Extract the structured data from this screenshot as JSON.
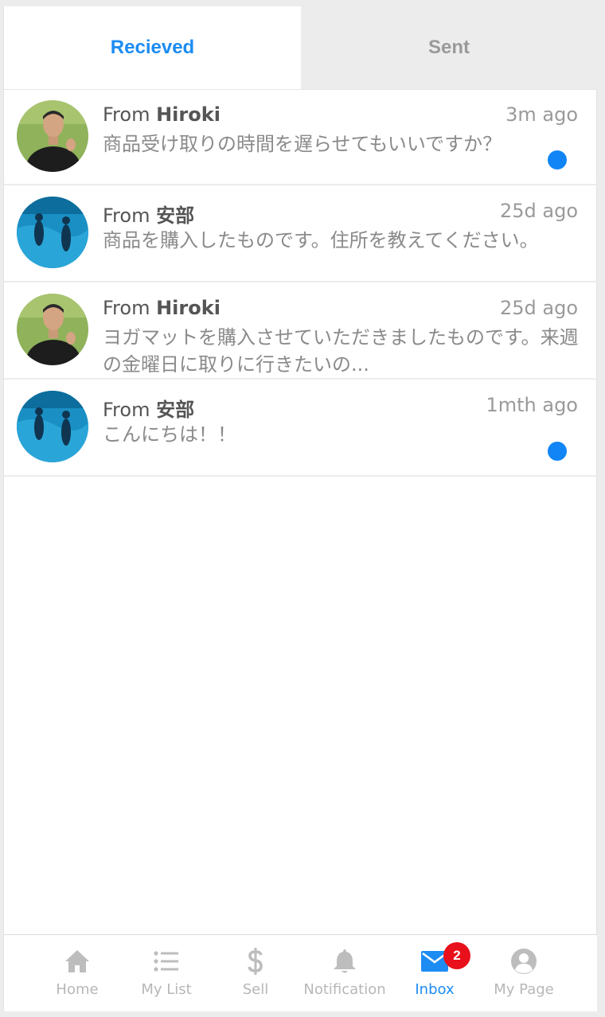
{
  "tabs": {
    "received_label": "Recieved",
    "sent_label": "Sent"
  },
  "messages": [
    {
      "from_prefix": "From ",
      "sender": "Hiroki",
      "time": "3m ago",
      "preview": "商品受け取りの時間を遅らせてもいいですか？",
      "unread": true,
      "avatar": "hiroki-photo"
    },
    {
      "from_prefix": "From ",
      "sender": "安部",
      "time": "25d ago",
      "preview": "商品を購入したものです。住所を教えてください。",
      "unread": false,
      "avatar": "abe-photo"
    },
    {
      "from_prefix": "From ",
      "sender": "Hiroki",
      "time": "25d ago",
      "preview": "ヨガマットを購入させていただきましたものです。来週の金曜日に取りに行きたいの...",
      "unread": false,
      "avatar": "hiroki-photo"
    },
    {
      "from_prefix": "From ",
      "sender": "安部",
      "time": "1mth ago",
      "preview": "こんにちは！！",
      "unread": true,
      "avatar": "abe-photo"
    }
  ],
  "bottom_nav": {
    "items": [
      {
        "label": "Home",
        "icon": "home-icon"
      },
      {
        "label": "My List",
        "icon": "list-icon"
      },
      {
        "label": "Sell",
        "icon": "dollar-icon"
      },
      {
        "label": "Notification",
        "icon": "bell-icon"
      },
      {
        "label": "Inbox",
        "icon": "mail-icon",
        "badge": "2"
      },
      {
        "label": "My Page",
        "icon": "user-circle-icon"
      }
    ],
    "active_item": "Inbox"
  },
  "colors": {
    "accent": "#1c8cf3",
    "unread_dot": "#1185f5",
    "badge": "#e8101a",
    "inactive_tab_bg": "#ececec",
    "inactive_text": "#b7b7b7"
  }
}
